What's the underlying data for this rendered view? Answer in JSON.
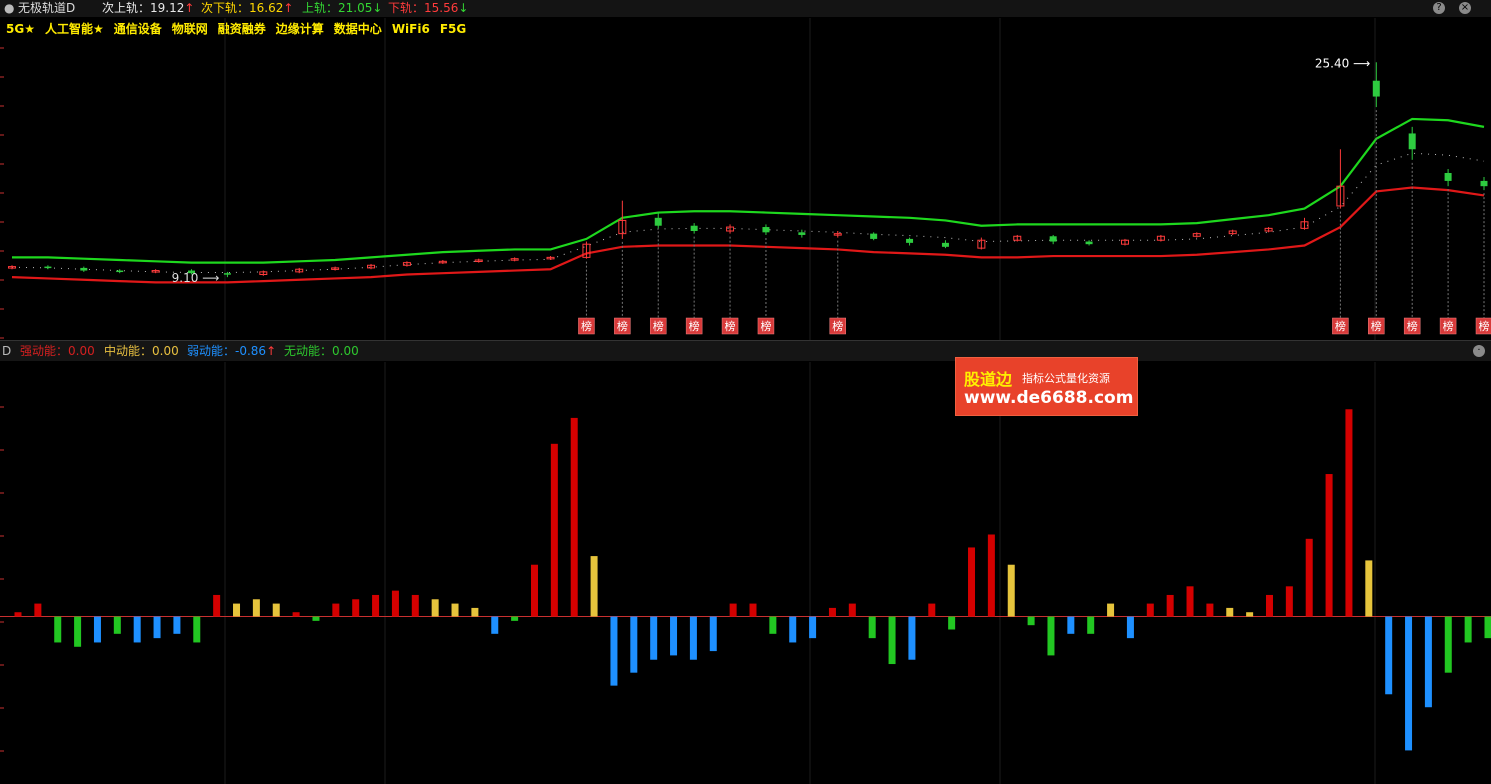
{
  "titlebar": {
    "name": "无极轨道D",
    "items": [
      {
        "label": "次上轨：19.12",
        "arrow": "↑",
        "color": "#e8e8e8",
        "arrow_color": "#ff3b3b"
      },
      {
        "label": "次下轨：16.62",
        "arrow": "↑",
        "color": "#ffd700",
        "arrow_color": "#ff3b3b"
      },
      {
        "label": "上轨：21.05",
        "arrow": "↓",
        "color": "#33d633",
        "arrow_color": "#33d633"
      },
      {
        "label": "下轨：15.56",
        "arrow": "↓",
        "color": "#ff3b3b",
        "arrow_color": "#33d633"
      }
    ],
    "help_icon": "question-icon",
    "close_icon": "close-icon"
  },
  "tags": [
    "5G★",
    "人工智能★",
    "通信设备",
    "物联网",
    "融资融券",
    "边缘计算",
    "数据中心",
    "WiFi6",
    "F5G"
  ],
  "indicator_bar": {
    "items": [
      {
        "label": "强动能：0.00",
        "color": "#d42020"
      },
      {
        "label": "中动能：0.00",
        "color": "#e8c040"
      },
      {
        "label": "弱动能：-0.86",
        "arrow": "↑",
        "color": "#1e90ff",
        "arrow_color": "#ff3b3b"
      },
      {
        "label": "无动能：0.00",
        "color": "#2ec82e"
      }
    ]
  },
  "watermark": {
    "line1": "股道边",
    "line1_sub": "指标公式量化资源",
    "line2": "www.de6688.com"
  },
  "colors": {
    "up": "#ff3b3b",
    "down": "#2ecc40",
    "upper_band": "#1ed81e",
    "lower_band": "#e01818",
    "strong": "#d40000",
    "medium": "#e6c43c",
    "weak": "#1e90ff",
    "none": "#22c722"
  },
  "chart_data": [
    {
      "type": "candlestick",
      "title": "无极轨道D",
      "annotations": [
        {
          "text": "9.10",
          "label": "low"
        },
        {
          "text": "25.40",
          "label": "high"
        }
      ],
      "marker_label": "榜",
      "marker_sub_label": "$",
      "upper_band": [
        10.6,
        10.6,
        10.5,
        10.4,
        10.3,
        10.2,
        10.2,
        10.2,
        10.3,
        10.4,
        10.6,
        10.8,
        11.0,
        11.1,
        11.2,
        11.2,
        12.0,
        13.6,
        14.0,
        14.1,
        14.1,
        14.0,
        13.9,
        13.8,
        13.7,
        13.6,
        13.4,
        13.0,
        13.1,
        13.1,
        13.1,
        13.1,
        13.1,
        13.2,
        13.5,
        13.8,
        14.3,
        16.0,
        19.6,
        21.1,
        21.0,
        20.5
      ],
      "lower_band": [
        9.1,
        9.0,
        8.9,
        8.8,
        8.7,
        8.7,
        8.7,
        8.8,
        8.9,
        9.0,
        9.1,
        9.3,
        9.4,
        9.5,
        9.6,
        9.7,
        10.9,
        11.4,
        11.5,
        11.5,
        11.5,
        11.4,
        11.3,
        11.2,
        11.0,
        10.9,
        10.8,
        10.6,
        10.6,
        10.7,
        10.7,
        10.7,
        10.7,
        10.8,
        11.0,
        11.2,
        11.5,
        12.9,
        15.6,
        15.9,
        15.7,
        15.3
      ],
      "candles": [
        {
          "o": 9.8,
          "c": 9.9,
          "h": 10.0,
          "l": 9.7
        },
        {
          "o": 9.9,
          "c": 9.8,
          "h": 10.0,
          "l": 9.7
        },
        {
          "o": 9.8,
          "c": 9.6,
          "h": 9.9,
          "l": 9.5
        },
        {
          "o": 9.6,
          "c": 9.5,
          "h": 9.7,
          "l": 9.4
        },
        {
          "o": 9.5,
          "c": 9.6,
          "h": 9.7,
          "l": 9.4
        },
        {
          "o": 9.6,
          "c": 9.4,
          "h": 9.7,
          "l": 9.3
        },
        {
          "o": 9.4,
          "c": 9.3,
          "h": 9.5,
          "l": 9.1
        },
        {
          "o": 9.3,
          "c": 9.5,
          "h": 9.6,
          "l": 9.2
        },
        {
          "o": 9.5,
          "c": 9.7,
          "h": 9.8,
          "l": 9.4
        },
        {
          "o": 9.7,
          "c": 9.8,
          "h": 9.9,
          "l": 9.6
        },
        {
          "o": 9.8,
          "c": 10.0,
          "h": 10.1,
          "l": 9.7
        },
        {
          "o": 10.0,
          "c": 10.2,
          "h": 10.3,
          "l": 9.9
        },
        {
          "o": 10.2,
          "c": 10.3,
          "h": 10.4,
          "l": 10.1
        },
        {
          "o": 10.3,
          "c": 10.4,
          "h": 10.5,
          "l": 10.2
        },
        {
          "o": 10.4,
          "c": 10.5,
          "h": 10.6,
          "l": 10.3
        },
        {
          "o": 10.5,
          "c": 10.6,
          "h": 10.7,
          "l": 10.4
        },
        {
          "o": 10.6,
          "c": 11.6,
          "h": 11.8,
          "l": 10.5
        },
        {
          "o": 12.4,
          "c": 13.4,
          "h": 14.9,
          "l": 12.0
        },
        {
          "o": 13.6,
          "c": 13.0,
          "h": 14.0,
          "l": 12.8
        },
        {
          "o": 13.0,
          "c": 12.6,
          "h": 13.2,
          "l": 12.4
        },
        {
          "o": 12.6,
          "c": 12.9,
          "h": 13.1,
          "l": 12.4
        },
        {
          "o": 12.9,
          "c": 12.5,
          "h": 13.1,
          "l": 12.3
        },
        {
          "o": 12.5,
          "c": 12.3,
          "h": 12.7,
          "l": 12.1
        },
        {
          "o": 12.3,
          "c": 12.4,
          "h": 12.6,
          "l": 12.1
        },
        {
          "o": 12.4,
          "c": 12.0,
          "h": 12.5,
          "l": 11.9
        },
        {
          "o": 12.0,
          "c": 11.7,
          "h": 12.1,
          "l": 11.5
        },
        {
          "o": 11.7,
          "c": 11.4,
          "h": 11.9,
          "l": 11.3
        },
        {
          "o": 11.3,
          "c": 11.9,
          "h": 12.1,
          "l": 11.2
        },
        {
          "o": 11.9,
          "c": 12.2,
          "h": 12.3,
          "l": 11.8
        },
        {
          "o": 12.2,
          "c": 11.8,
          "h": 12.3,
          "l": 11.6
        },
        {
          "o": 11.8,
          "c": 11.6,
          "h": 11.9,
          "l": 11.5
        },
        {
          "o": 11.6,
          "c": 11.9,
          "h": 12.0,
          "l": 11.5
        },
        {
          "o": 11.9,
          "c": 12.2,
          "h": 12.3,
          "l": 11.8
        },
        {
          "o": 12.2,
          "c": 12.4,
          "h": 12.5,
          "l": 12.1
        },
        {
          "o": 12.4,
          "c": 12.6,
          "h": 12.7,
          "l": 12.3
        },
        {
          "o": 12.6,
          "c": 12.8,
          "h": 12.9,
          "l": 12.5
        },
        {
          "o": 12.8,
          "c": 13.3,
          "h": 13.6,
          "l": 12.7
        },
        {
          "o": 14.5,
          "c": 16.0,
          "h": 18.8,
          "l": 14.3
        },
        {
          "o": 24.0,
          "c": 22.8,
          "h": 25.4,
          "l": 22.0
        },
        {
          "o": 20.0,
          "c": 18.8,
          "h": 20.5,
          "l": 18.0
        },
        {
          "o": 17.0,
          "c": 16.4,
          "h": 17.3,
          "l": 16.0
        },
        {
          "o": 16.4,
          "c": 16.0,
          "h": 16.7,
          "l": 15.7
        }
      ],
      "ylim": [
        6,
        28
      ]
    },
    {
      "type": "bar",
      "series": [
        {
          "name": "强动能",
          "color": "#d40000"
        },
        {
          "name": "中动能",
          "color": "#e6c43c"
        },
        {
          "name": "弱动能",
          "color": "#1e90ff"
        },
        {
          "name": "无动能",
          "color": "#22c722"
        }
      ],
      "values": [
        0.1,
        0.3,
        -0.6,
        -0.7,
        -0.6,
        -0.4,
        -0.6,
        -0.5,
        -0.4,
        -0.6,
        0.5,
        0.3,
        0.4,
        0.3,
        0.1,
        -0.1,
        0.3,
        0.4,
        0.5,
        0.6,
        0.5,
        0.4,
        0.3,
        0.2,
        -0.4,
        -0.1,
        1.2,
        4.0,
        4.6,
        1.4,
        -1.6,
        -1.3,
        -1.0,
        -0.9,
        -1.0,
        -0.8,
        0.3,
        0.3,
        -0.4,
        -0.6,
        -0.5,
        0.2,
        0.3,
        -0.5,
        -1.1,
        -1.0,
        0.3,
        -0.3,
        1.6,
        1.9,
        1.2,
        -0.2,
        -0.9,
        -0.4,
        -0.4,
        0.3,
        -0.5,
        0.3,
        0.5,
        0.7,
        0.3,
        0.2,
        0.1,
        0.5,
        0.7,
        1.8,
        3.3,
        4.8,
        1.3,
        -1.8,
        -3.1,
        -2.1,
        -1.3,
        -0.6,
        -0.5
      ],
      "categories": [
        "strong",
        "strong",
        "none",
        "none",
        "weak",
        "none",
        "weak",
        "weak",
        "weak",
        "none",
        "strong",
        "medium",
        "medium",
        "medium",
        "strong",
        "none",
        "strong",
        "strong",
        "strong",
        "strong",
        "strong",
        "medium",
        "medium",
        "medium",
        "weak",
        "none",
        "strong",
        "strong",
        "strong",
        "medium",
        "weak",
        "weak",
        "weak",
        "weak",
        "weak",
        "weak",
        "strong",
        "strong",
        "none",
        "weak",
        "weak",
        "strong",
        "strong",
        "none",
        "none",
        "weak",
        "strong",
        "none",
        "strong",
        "strong",
        "medium",
        "none",
        "none",
        "weak",
        "none",
        "medium",
        "weak",
        "strong",
        "strong",
        "strong",
        "strong",
        "medium",
        "medium",
        "strong",
        "strong",
        "strong",
        "strong",
        "strong",
        "medium",
        "weak",
        "weak",
        "weak",
        "none",
        "none",
        "none"
      ],
      "ylim": [
        -3.6,
        5.2
      ]
    }
  ]
}
